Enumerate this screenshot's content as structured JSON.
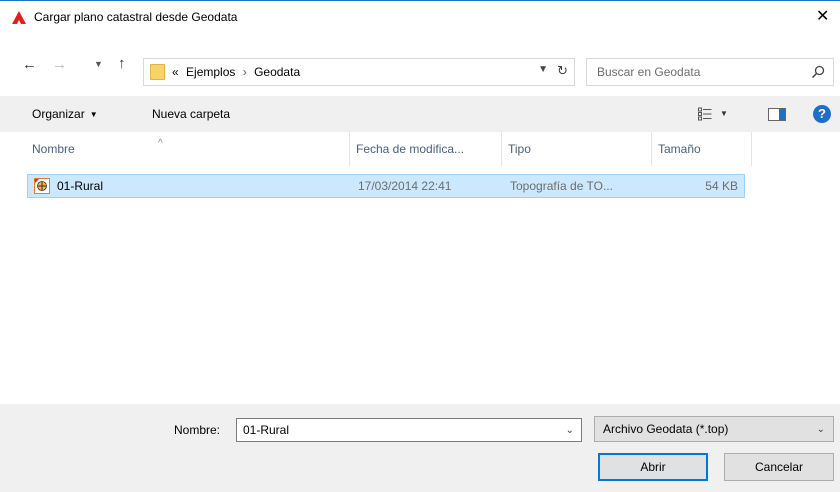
{
  "window": {
    "title": "Cargar plano catastral desde Geodata"
  },
  "nav": {
    "back": "←",
    "forward": "→",
    "recent": "⌄",
    "up": "↑"
  },
  "address": {
    "overflow": "«",
    "crumbs": [
      "Ejemplos",
      "Geodata"
    ],
    "separator": "›"
  },
  "search": {
    "placeholder": "Buscar en Geodata"
  },
  "toolbar": {
    "organize_label": "Organizar",
    "new_folder_label": "Nueva carpeta"
  },
  "columns": {
    "name": "Nombre",
    "date": "Fecha de modifica...",
    "type": "Tipo",
    "size": "Tamaño"
  },
  "files": [
    {
      "name": "01-Rural",
      "date": "17/03/2014 22:41",
      "type": "Topografía de TO...",
      "size": "54 KB"
    }
  ],
  "footer": {
    "name_label": "Nombre:",
    "name_value": "01-Rural",
    "file_type": "Archivo Geodata (*.top)",
    "open_label": "Abrir",
    "cancel_label": "Cancelar"
  },
  "colors": {
    "selection_bg": "#cce8ff",
    "selection_border": "#99d1ff",
    "accent": "#0078d7",
    "app_icon": "#e02020"
  }
}
